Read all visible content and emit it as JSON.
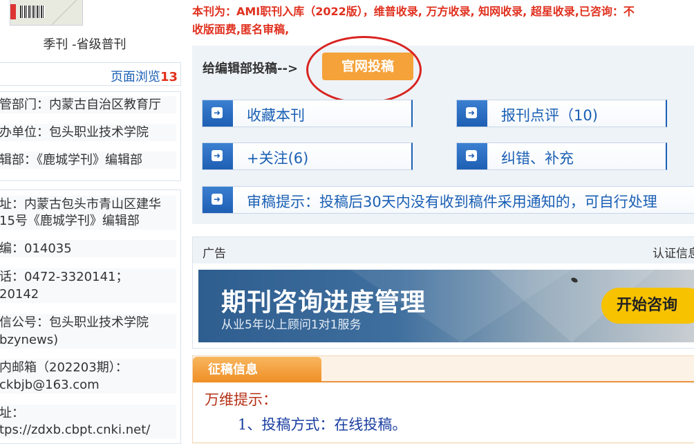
{
  "left": {
    "frequency": "季刊 -省级普刊",
    "views_label": "页面浏览",
    "views_count": "13",
    "info1": [
      "管部门：内蒙古自治区教育厅",
      "办单位：包头职业技术学院",
      "辑部：《鹿城学刊》编辑部"
    ],
    "info2": [
      "址：内蒙古包头市青山区建华",
      "15号《鹿城学刊》编辑部",
      "编：014035",
      "话：0472-3320141；",
      "20142",
      "信公号：包头职业技术学院",
      "bzynews)",
      "内邮箱（202203期）：",
      "ckbjb@163.com",
      "址：",
      "tps://zdxb.cbpt.cnki.net/"
    ]
  },
  "notice": {
    "line1": "本刊为：AMI职刊入库（2022版），维普收录, 万方收录, 知网收录, 超星收录,已咨询：不",
    "line2": "收版面费,匿名审稿,"
  },
  "submit": {
    "label": "给编辑部投稿-->",
    "button": "官网投稿"
  },
  "actions": {
    "collect": "收藏本刊",
    "review": "报刊点评（10)",
    "follow": "+关注(6)",
    "correct": "纠错、补充",
    "tip": "审稿提示：投稿后30天内没有收到稿件采用通知的，可自行处理"
  },
  "ad": {
    "label": "广告",
    "cert": "认证信息",
    "banner_title": "期刊咨询进度管理",
    "banner_sub": "从业5年以上顾问1对1服务",
    "banner_button": "开始咨询"
  },
  "call": {
    "tab": "征稿信息",
    "title": "万维提示：",
    "item1": "1、投稿方式：在线投稿。"
  }
}
